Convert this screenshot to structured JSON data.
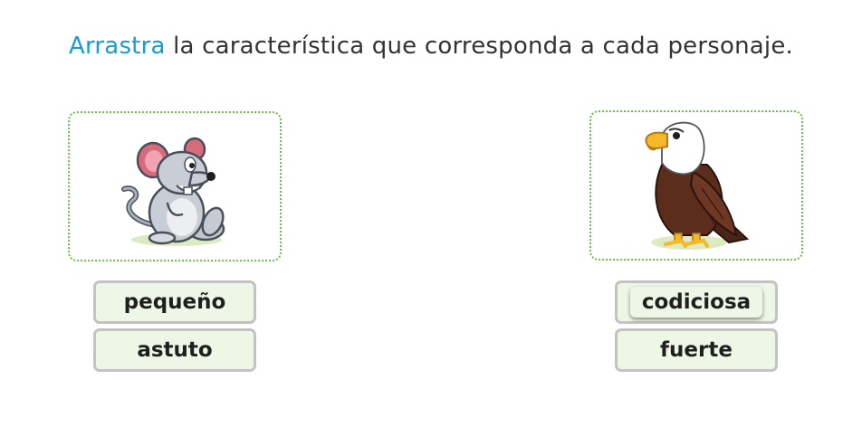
{
  "instruction": {
    "verb": "Arrastra",
    "rest": " la característica que corresponda a cada personaje."
  },
  "colors": {
    "verb": "#1a9bd7",
    "card_border": "#6cbf4a",
    "slot_bg": "#eef6e6",
    "slot_border": "#c3c3c3"
  },
  "characters": [
    {
      "icon": "mouse-illustration"
    },
    {
      "icon": "eagle-illustration"
    }
  ],
  "slots": [
    {
      "label": "pequeño"
    },
    {
      "label": "astuto"
    },
    {
      "label": "codiciosa",
      "state": "dragging-chip"
    },
    {
      "label": "fuerte"
    }
  ]
}
